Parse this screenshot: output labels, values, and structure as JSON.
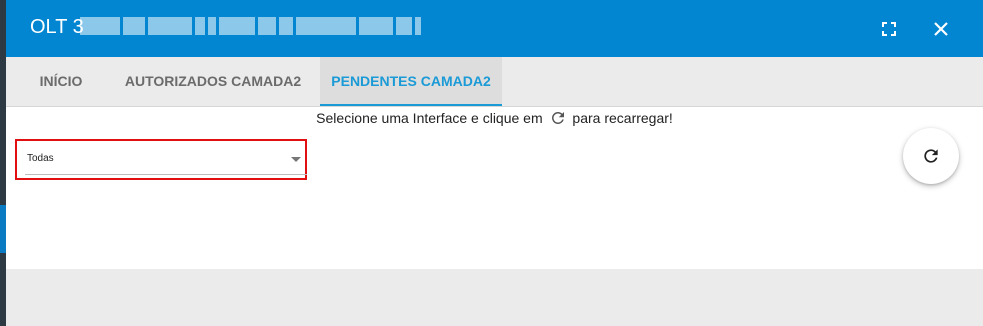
{
  "header": {
    "title": "OLT 3",
    "expand_icon": "fullscreen-icon",
    "close_icon": "close-icon",
    "color": "#0286d1"
  },
  "tabs": [
    {
      "label": "INÍCIO",
      "active": false
    },
    {
      "label": "AUTORIZADOS CAMADA2",
      "active": false
    },
    {
      "label": "PENDENTES CAMADA2",
      "active": true
    }
  ],
  "interface_select": {
    "value": "Todas"
  },
  "refresh_button": {
    "icon": "refresh-icon"
  },
  "message": {
    "before": "Selecione uma Interface e clique em",
    "after": "para recarregar!",
    "icon": "refresh-icon"
  },
  "colors": {
    "accent": "#1a9ad6",
    "highlight": "#e10f0f"
  }
}
